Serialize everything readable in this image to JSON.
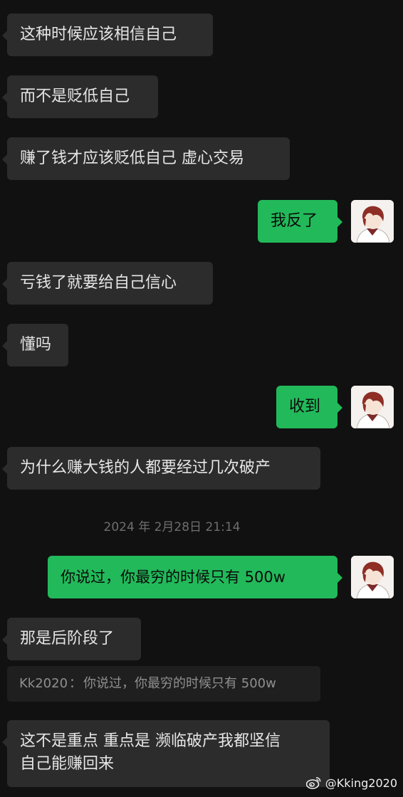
{
  "messages": [
    {
      "side": "left",
      "text": "这种时候应该相信自己"
    },
    {
      "side": "left",
      "text": "而不是贬低自己"
    },
    {
      "side": "left",
      "text": "赚了钱才应该贬低自己 虚心交易"
    },
    {
      "side": "right",
      "text": "我反了"
    },
    {
      "side": "left",
      "text": "亏钱了就要给自己信心"
    },
    {
      "side": "left",
      "text": "懂吗"
    },
    {
      "side": "right",
      "text": "收到"
    },
    {
      "side": "left",
      "text": "为什么赚大钱的人都要经过几次破产"
    },
    {
      "side": "right",
      "text": "你说过，你最穷的时候只有 500w"
    },
    {
      "side": "left",
      "text": "那是后阶段了"
    },
    {
      "side": "left",
      "line1": "这不是重点 重点是 濒临破产我都坚信",
      "line2": "自己能赚回来"
    }
  ],
  "timestamp": "2024 年 2月28日 21:14",
  "quote": {
    "sender": "Kk2020",
    "separator": "：",
    "text": "你说过，你最穷的时候只有 500w"
  },
  "watermark": {
    "handle": "@Kking2020",
    "icon": "weibo-icon"
  },
  "colors": {
    "background": "#111111",
    "incoming_bubble": "#2c2c2c",
    "outgoing_bubble": "#22b95a",
    "timestamp_text": "#6e6e6e"
  }
}
